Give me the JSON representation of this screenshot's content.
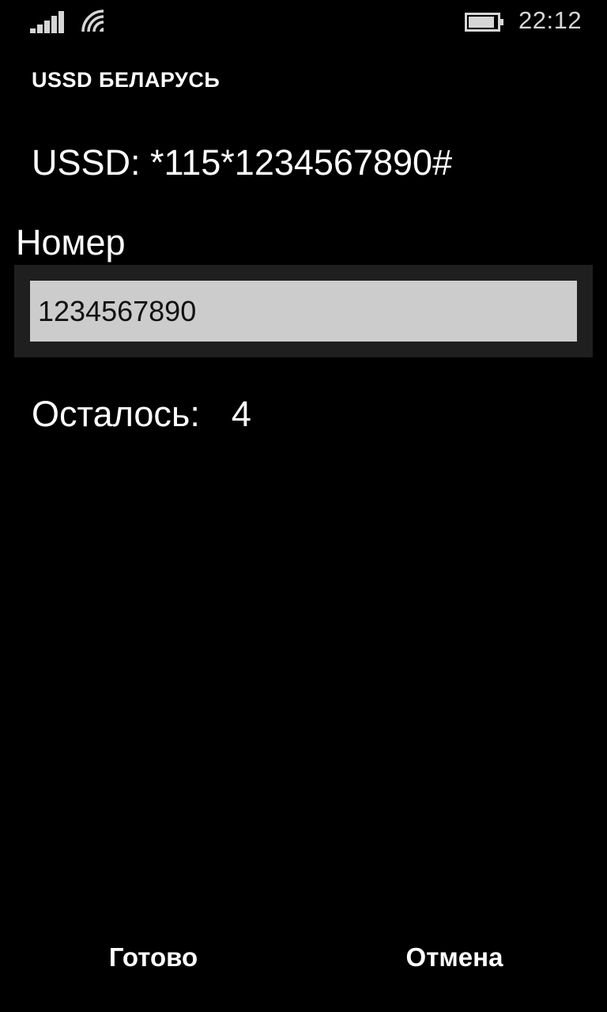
{
  "status_bar": {
    "time": "22:12",
    "icons": [
      "signal-icon",
      "wifi-icon",
      "battery-icon"
    ]
  },
  "app": {
    "title": "USSD БЕЛАРУСЬ"
  },
  "ussd": {
    "text": "USSD: *115*1234567890#"
  },
  "number": {
    "label": "Номер",
    "value": "1234567890"
  },
  "remaining": {
    "label": "Осталось:",
    "value": "4"
  },
  "buttons": {
    "done_label": "Готово",
    "cancel_label": "Отмена"
  },
  "colors": {
    "background": "#000000",
    "input_background": "#cccccc",
    "input_frame": "#1f1f1f",
    "text": "#ffffff"
  }
}
